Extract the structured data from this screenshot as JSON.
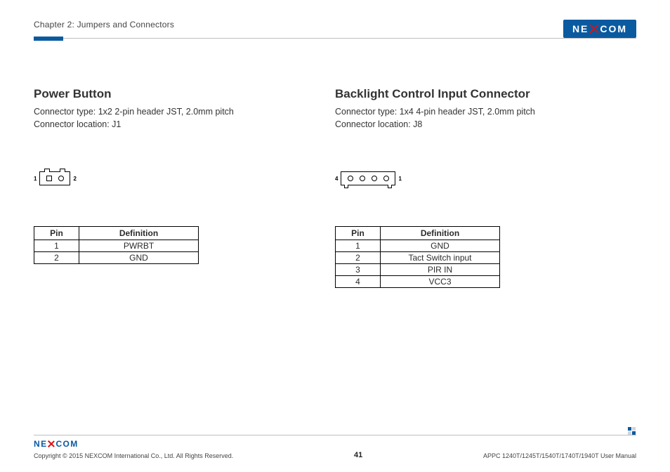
{
  "header": {
    "chapter": "Chapter 2: Jumpers and Connectors",
    "logo_text_left": "NE",
    "logo_text_right": "COM"
  },
  "left": {
    "title": "Power Button",
    "spec_type": "Connector type: 1x2 2-pin header JST, 2.0mm pitch",
    "spec_loc": "Connector location: J1",
    "pin_left": "1",
    "pin_right": "2",
    "table": {
      "h_pin": "Pin",
      "h_def": "Definition",
      "rows": [
        {
          "pin": "1",
          "def": "PWRBT"
        },
        {
          "pin": "2",
          "def": "GND"
        }
      ]
    }
  },
  "right": {
    "title": "Backlight Control Input Connector",
    "spec_type": "Connector type: 1x4 4-pin header JST, 2.0mm pitch",
    "spec_loc": "Connector location: J8",
    "pin_left": "4",
    "pin_right": "1",
    "table": {
      "h_pin": "Pin",
      "h_def": "Definition",
      "rows": [
        {
          "pin": "1",
          "def": "GND"
        },
        {
          "pin": "2",
          "def": "Tact Switch input"
        },
        {
          "pin": "3",
          "def": "PIR IN"
        },
        {
          "pin": "4",
          "def": "VCC3"
        }
      ]
    }
  },
  "footer": {
    "copyright": "Copyright © 2015 NEXCOM International Co., Ltd. All Rights Reserved.",
    "page": "41",
    "manual": "APPC 1240T/1245T/1540T/1740T/1940T User Manual",
    "logo_text_left": "NE",
    "logo_text_right": "COM"
  }
}
